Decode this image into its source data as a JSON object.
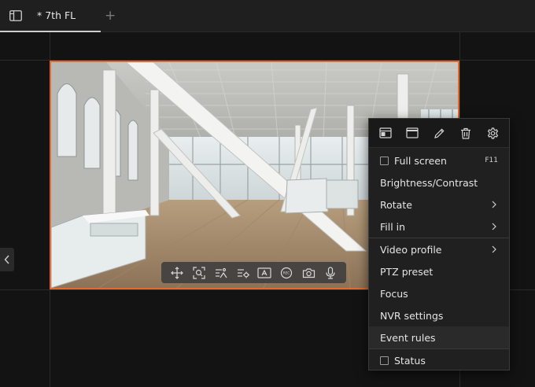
{
  "tabs": {
    "layout_icon": "layout-icon",
    "active_tab": "* 7th FL",
    "add_tab": "+"
  },
  "nav": {
    "prev_icon": "chevron-left-icon"
  },
  "camera": {
    "scene": "building atrium camera feed",
    "frame_color": "#e36a2c",
    "toolbar": [
      {
        "name": "move-icon"
      },
      {
        "name": "zoom-icon"
      },
      {
        "name": "image-adjust-icon"
      },
      {
        "name": "settings-slider-icon"
      },
      {
        "name": "text-overlay-icon"
      },
      {
        "name": "record-icon"
      },
      {
        "name": "snapshot-icon"
      },
      {
        "name": "microphone-icon"
      }
    ]
  },
  "menu": {
    "top_icons": [
      "window-icon",
      "maximize-icon",
      "edit-icon",
      "delete-icon",
      "gear-icon"
    ],
    "items": [
      {
        "label": "Full screen",
        "shortcut": "F11"
      },
      {
        "label": "Brightness/Contrast"
      },
      {
        "label": "Rotate"
      },
      {
        "label": "Fill in"
      },
      {
        "label": "Video profile"
      },
      {
        "label": "PTZ preset"
      },
      {
        "label": "Focus"
      },
      {
        "label": "NVR settings"
      },
      {
        "label": "Event rules"
      },
      {
        "label": "Status"
      }
    ]
  }
}
